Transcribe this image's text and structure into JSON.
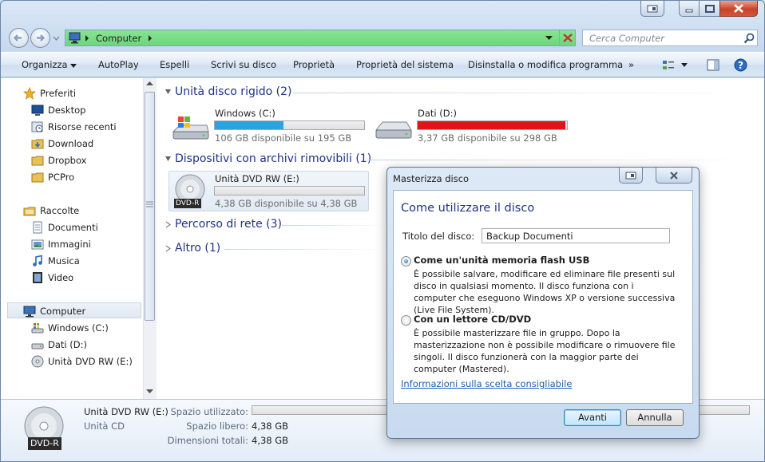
{
  "address": {
    "path": "Computer"
  },
  "search": {
    "placeholder": "Cerca Computer"
  },
  "toolbar": {
    "items": [
      "Organizza",
      "AutoPlay",
      "Espelli",
      "Scrivi su disco",
      "Proprietà",
      "Proprietà del sistema",
      "Disinstalla o modifica programma"
    ],
    "more": "»"
  },
  "nav": {
    "favorites": {
      "label": "Preferiti",
      "items": [
        "Desktop",
        "Risorse recenti",
        "Download",
        "Dropbox",
        "PCPro"
      ]
    },
    "libraries": {
      "label": "Raccolte",
      "items": [
        "Documenti",
        "Immagini",
        "Musica",
        "Video"
      ]
    },
    "computer": {
      "label": "Computer",
      "items": [
        "Windows (C:)",
        "Dati (D:)",
        "Unità DVD RW (E:)"
      ]
    }
  },
  "content": {
    "groups": {
      "hdd": "Unità disco rigido (2)",
      "removable": "Dispositivi con archivi rimovibili (1)",
      "network": "Percorso di rete (3)",
      "other": "Altro (1)"
    },
    "drives": [
      {
        "name": "Windows (C:)",
        "free": "106 GB disponibile su 195 GB",
        "used_fraction": 0.46,
        "color": "#2aa4e0"
      },
      {
        "name": "Dati (D:)",
        "free": "3,37 GB disponibile su 298 GB",
        "used_fraction": 0.99,
        "color": "#e0151b"
      },
      {
        "name": "Unità DVD RW (E:)",
        "free": "4,38 GB disponibile su 4,38 GB",
        "used_fraction": 0.0,
        "color": "#2aa4e0",
        "badge": "DVD-R"
      }
    ]
  },
  "details": {
    "name": "Unità DVD RW (E:)",
    "type": "Unità CD",
    "badge": "DVD-R",
    "used_label": "Spazio utilizzato:",
    "free_label": "Spazio libero:",
    "free_value": "4,38 GB",
    "total_label": "Dimensioni totali:",
    "total_value": "4,38 GB"
  },
  "dialog": {
    "title": "Masterizza disco",
    "heading": "Come utilizzare il disco",
    "disc_title_label": "Titolo del disco:",
    "disc_title_value": "Backup Documenti",
    "option1_title": "Come un'unità memoria flash USB",
    "option1_desc": "È possibile salvare, modificare ed eliminare file presenti sul disco in qualsiasi momento. Il disco funziona con i computer che eseguono Windows XP o versione successiva (Live File System).",
    "option2_title": "Con un lettore CD/DVD",
    "option2_desc": "È possibile masterizzare file in gruppo. Dopo la masterizzazione non è possibile modificare o rimuovere file singoli. Il disco funzionerà con la maggior parte dei computer (Mastered).",
    "help_link": "Informazioni sulla scelta consigliabile",
    "next_button": "Avanti",
    "cancel_button": "Annulla"
  },
  "colors": {
    "accent": "#1e3287",
    "address_bg": "#6cd779",
    "link": "#1a5fb4"
  }
}
